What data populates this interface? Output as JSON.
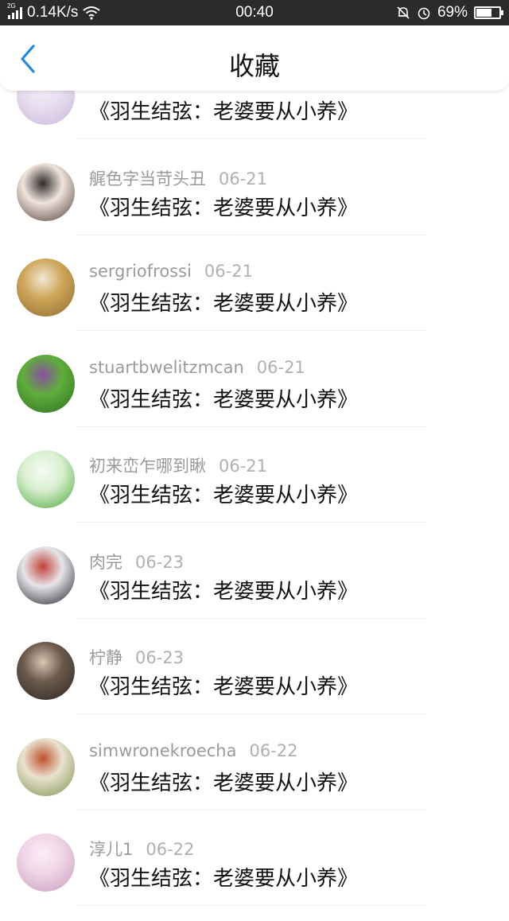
{
  "status_bar": {
    "network": "2G",
    "speed": "0.14K/s",
    "time": "00:40",
    "battery_percent": "69%",
    "battery_level": 0.69,
    "icons": [
      "signal-icon",
      "wifi-icon",
      "mute-bell-icon",
      "alarm-icon",
      "battery-icon"
    ]
  },
  "header": {
    "title": "收藏",
    "back_icon": "chevron-left-icon",
    "accent_color": "#1e88e5"
  },
  "favorites": [
    {
      "username": "",
      "date": "",
      "title": "《羽生结弦：老婆要从小养》",
      "avatar_colors": [
        "#e8dff0",
        "#cbb6d8",
        "#f4eef8"
      ]
    },
    {
      "username": "艉色字当苛头丑",
      "date": "06-21",
      "title": "《羽生结弦：老婆要从小养》",
      "avatar_colors": [
        "#f1e4dc",
        "#4a3a34",
        "#2c2c2c"
      ]
    },
    {
      "username": "sergriofrossi",
      "date": "06-21",
      "title": "《羽生结弦：老婆要从小养》",
      "avatar_colors": [
        "#cfa65a",
        "#8c6b2e",
        "#f0e8d6"
      ]
    },
    {
      "username": "stuartbwelitzmcan",
      "date": "06-21",
      "title": "《羽生结弦：老婆要从小养》",
      "avatar_colors": [
        "#5fae3b",
        "#2f6e1f",
        "#8a4fa0"
      ]
    },
    {
      "username": "初来峦乍哪到瞅",
      "date": "06-21",
      "title": "《羽生结弦：老婆要从小养》",
      "avatar_colors": [
        "#d9efd0",
        "#4aa83a",
        "#f6fbf3"
      ]
    },
    {
      "username": "肉完",
      "date": "06-23",
      "title": "《羽生结弦：老婆要从小养》",
      "avatar_colors": [
        "#e6e6ea",
        "#1b1b24",
        "#c4413a"
      ]
    },
    {
      "username": "柠静",
      "date": "06-23",
      "title": "《羽生结弦：老婆要从小养》",
      "avatar_colors": [
        "#6b5a4c",
        "#2a2522",
        "#d8c7b3"
      ]
    },
    {
      "username": "simwronekroecha",
      "date": "06-22",
      "title": "《羽生结弦：老婆要从小养》",
      "avatar_colors": [
        "#e9e2cf",
        "#7a8f4a",
        "#c0502e"
      ]
    },
    {
      "username": "淳儿1",
      "date": "06-22",
      "title": "《羽生结弦：老婆要从小养》",
      "avatar_colors": [
        "#f0d6e6",
        "#c79ac0",
        "#fbeef5"
      ]
    }
  ]
}
